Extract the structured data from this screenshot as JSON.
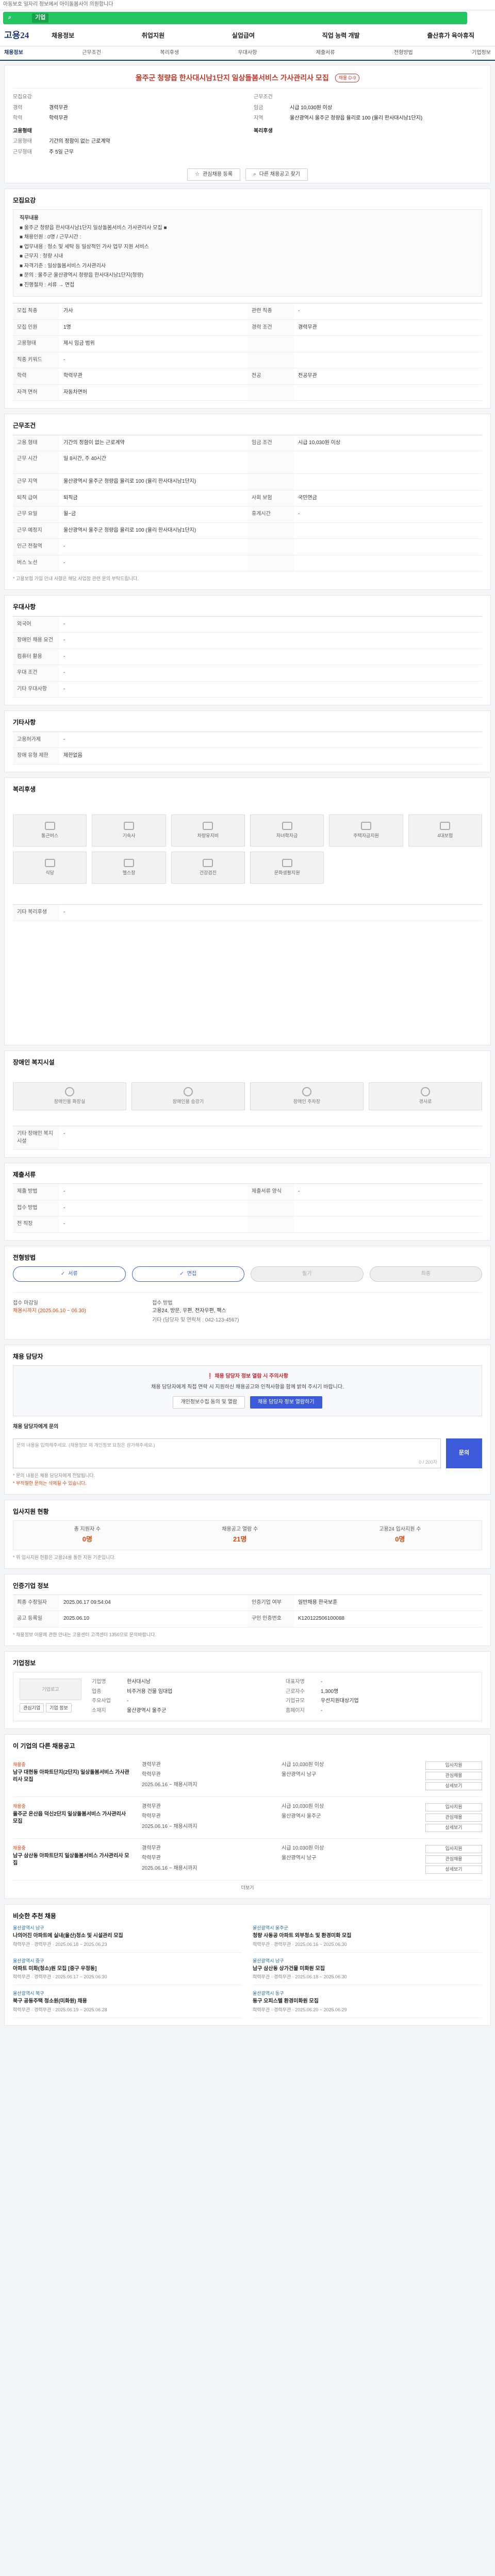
{
  "topbar": {
    "text": "아동보호 일자리 정보에서 아이돌봄사이 의원합니다"
  },
  "search": {
    "label": "기업",
    "value": ""
  },
  "gnb": {
    "logo": "고용24",
    "menu": [
      "채용정보",
      "취업지원",
      "실업급여",
      "직업 능력 개발",
      "출산휴가 육아휴직"
    ]
  },
  "tabs": [
    {
      "label": "채용정보",
      "active": true
    },
    {
      "label": "근무조건"
    },
    {
      "label": "복리후생"
    },
    {
      "label": "우대사항"
    },
    {
      "label": "제출서류"
    },
    {
      "label": "전형방법"
    },
    {
      "label": "기업정보"
    }
  ],
  "job": {
    "title": "울주군 청량읍 한사대시남1단지 일상돌봄서비스 가사관리사 모집",
    "status": "채용 D-9",
    "left": [
      {
        "k": "모집요강",
        "v": ""
      },
      {
        "k": "경력",
        "v": "경력무관"
      },
      {
        "k": "학력",
        "v": "학력무관"
      }
    ],
    "left_sub_title": "고용형태",
    "left_sub": [
      {
        "k": "고용형태",
        "v": "기간의 정함이 없는 근로계약"
      },
      {
        "k": "근무형태",
        "v": "주 5일 근무"
      }
    ],
    "right": [
      {
        "k": "근무조건",
        "v": ""
      },
      {
        "k": "임금",
        "v": "시급 10,030원 이상"
      },
      {
        "k": "지역",
        "v": "울산광역시 울주군 청량읍 율리로 100 (율리 한사대시남1단지)"
      }
    ],
    "right_sub_title": "복리후생",
    "buttons": [
      "관심채용 등록",
      "다른 채용공고 찾기"
    ]
  },
  "recruit_summary": {
    "title": "모집요강",
    "box_title": "직무내용",
    "lines": [
      "■ 울주군 청량읍 한사대시남1단지 일상돌봄서비스 가사관리사 모집 ■",
      "■ 채용인원 : 0명 / 근무시간 :",
      "■ 업무내용 : 청소 및 세탁 등 일상적인 가사 업무 지원 서비스",
      "■ 근무지 : 청량 시내",
      "■ 자격기준 : 일상돌봄서비스 가사관리사",
      "■ 문의 : 울주군 울산광역시 청량읍 한사대시남1단지(청량)",
      "■ 진행절차 : 서류 → 면접"
    ]
  },
  "recruit_grid": [
    [
      "모집 직종",
      "가사",
      "관련 직종",
      "-"
    ],
    [
      "모집 인원",
      "1명",
      "경력 조건",
      "경력무관"
    ],
    [
      "고용형태",
      "제시 임금 범위",
      "",
      ""
    ],
    [
      "직종 키워드",
      "-",
      "",
      ""
    ],
    [
      "학력",
      "학력무관",
      "전공",
      "전공무관"
    ],
    [
      "자격 면허",
      "자동차면허",
      "",
      ""
    ]
  ],
  "work_conditions": {
    "title": "근무조건",
    "rows": [
      [
        "고용 형태",
        "기간의 정함이 없는 근로계약",
        "임금 조건",
        "시급 10,030원 이상"
      ],
      [
        "근무 시간",
        "일 8시간, 주 40시간",
        "",
        ""
      ],
      [
        "근무 지역",
        "울산광역시 울주군 청량읍 율리로 100 (율리 한사대시남1단지)",
        "",
        ""
      ],
      [
        "퇴직 급여",
        "퇴직금",
        "사회 보험",
        "국민연금"
      ],
      [
        "근무 요일",
        "월~금",
        "휴게시간",
        "-"
      ],
      [
        "근무 예정지",
        "울산광역시 울주군 청량읍 율리로 100 (율리 한사대시남1단지)",
        "",
        ""
      ],
      [
        "인근 전철역",
        "-",
        "",
        ""
      ],
      [
        "버스 노선",
        "-",
        "",
        ""
      ]
    ],
    "note": "* 고용보험 가입 안내 사항은 해당 사업장 관련 문의 부탁드립니다."
  },
  "preference": {
    "title": "우대사항",
    "rows": [
      [
        "외국어",
        "-"
      ],
      [
        "장애인 채용 요건",
        "-"
      ],
      [
        "컴퓨터 활용",
        "-"
      ],
      [
        "우대 조건",
        "-"
      ],
      [
        "기타 우대사항",
        "-"
      ]
    ]
  },
  "etc_info": {
    "title": "기타사항",
    "rows": [
      [
        "고용허가제",
        "-"
      ],
      [
        "장애 유형 제한",
        "제한없음"
      ]
    ]
  },
  "welfare": {
    "title": "복리후생",
    "items": [
      "통근버스",
      "기숙사",
      "차량유지비",
      "자녀학자금",
      "주택자금지원",
      "4대보험",
      "식당",
      "헬스장",
      "건강검진",
      "문화생활지원"
    ],
    "etc_label": "기타 복리후생",
    "etc_value": "-"
  },
  "disability": {
    "title": "장애인 복지시설",
    "items": [
      "장애인용 화장실",
      "장애인용 승강기",
      "장애인 주차장",
      "경사로"
    ],
    "etc_label": "기타 장애인 복지시설",
    "etc_value": "-"
  },
  "documents": {
    "title": "제출서류",
    "rows": [
      [
        "제출 방법",
        "-",
        "제출서류 양식",
        "-"
      ],
      [
        "접수 방법",
        "-",
        "",
        ""
      ],
      [
        "전 직장",
        "-",
        "",
        ""
      ]
    ]
  },
  "screening": {
    "title": "전형방법",
    "steps": [
      {
        "label": "서류",
        "state": "done"
      },
      {
        "label": "면접",
        "state": "done"
      },
      {
        "label": "필기",
        "state": "off"
      },
      {
        "label": "최종",
        "state": "off"
      }
    ],
    "deadline_label": "접수 마감일",
    "deadline_value": "채용시까지 (2025.06.10 ~ 06.30)",
    "method_label": "접수 방법",
    "method_value": "고용24, 방문, 우편, 전자우편, 팩스",
    "contact": "기타 (담당자 및 연락처 : 042-123-4567)"
  },
  "inquiry": {
    "title": "채용 담당자",
    "warn": "채용 담당자 정보 열람 시 주의사항",
    "desc": "채용 담당자에게 직접 연락 시 지원하신 채용공고와 인적사항을 함께 밝혀 주시기 바랍니다.",
    "buttons": [
      "개인정보수집 동의 및 열람",
      "채용 담당자 정보 열람하기"
    ],
    "form_title": "채용 담당자에게 문의",
    "placeholder": "문의 내용을 입력해주세요. (채용정보 외 개인정보 요청은 삼가해주세요.)",
    "counter": "0 / 200자",
    "submit": "문의",
    "notes": [
      "* 문의 내용은 채용 담당자에게 전달됩니다.",
      "* 부적절한 문의는 삭제될 수 있습니다."
    ]
  },
  "stats": {
    "title": "입사지원 현황",
    "items": [
      {
        "label": "총 지원자 수",
        "value": "0명"
      },
      {
        "label": "채용공고 열람 수",
        "value": "21명"
      },
      {
        "label": "고용24 입사지원 수",
        "value": "0명"
      }
    ],
    "note": "* 위 입사지원 현황은 고용24를 통한 지원 기준입니다."
  },
  "registry": {
    "title": "인증기업 정보",
    "rows": [
      [
        "최종 수정일자",
        "2025.06.17 09:54:04",
        "인증기업 여부",
        "일반채용 한국보훈"
      ],
      [
        "공고 등록일",
        "2025.06.10",
        "구인 인증번호",
        "K120122506100088"
      ]
    ],
    "note": "* 채용정보 이용에 관한 안내는 고용센터 고객센터 1350으로 문의바랍니다."
  },
  "company": {
    "title": "기업정보",
    "logo_alt": "기업로고",
    "rows": [
      [
        "기업명",
        "한사대시남",
        "대표자명",
        "-"
      ],
      [
        "업종",
        "비주거용 건물 임대업",
        "근로자수",
        "1,300명"
      ],
      [
        "주요사업",
        "-",
        "기업규모",
        "우선지원대상기업"
      ],
      [
        "소재지",
        "울산광역시 울주군",
        "홈페이지",
        "-"
      ]
    ],
    "buttons": [
      "관심기업",
      "기업 정보"
    ]
  },
  "other_jobs": {
    "title": "이 기업의 다른 채용공고",
    "items": [
      {
        "tag": "채용중",
        "title": "남구 대현동 아파트단지(2단지) 일상돌봄서비스 가사관리사 모집",
        "career": "경력무관",
        "edu": "학력무관",
        "pay": "시급 10,030원 이상",
        "loc": "울산광역시 남구",
        "date": "2025.06.16 ~ 채용시까지"
      },
      {
        "tag": "채용중",
        "title": "울주군 온산읍 덕신2단지 일상돌봄서비스 가사관리사 모집",
        "career": "경력무관",
        "edu": "학력무관",
        "pay": "시급 10,030원 이상",
        "loc": "울산광역시 울주군",
        "date": "2025.06.16 ~ 채용시까지"
      },
      {
        "tag": "채용중",
        "title": "남구 삼산동 아파트단지 일상돌봄서비스 가사관리사 모집",
        "career": "경력무관",
        "edu": "학력무관",
        "pay": "시급 10,030원 이상",
        "loc": "울산광역시 남구",
        "date": "2025.06.16 ~ 채용시까지"
      }
    ],
    "item_buttons": [
      "입사지원",
      "관심채용",
      "상세보기"
    ]
  },
  "recommend": {
    "title": "비슷한 추천 채용",
    "items": [
      {
        "tag": "울산광역시 남구",
        "title": "나의어진 아파트에 실내(울산)청소 및 시설관리 모집",
        "meta": "학력무관 · 경력무관 · 2025.06.18 ~ 2025.06.23"
      },
      {
        "tag": "울산광역시 울주군",
        "title": "청량 사동공 아파트 외부청소 및 환경미화 모집",
        "meta": "학력무관 · 경력무관 · 2025.06.16 ~ 2025.06.30"
      },
      {
        "tag": "울산광역시 중구",
        "title": "아파트 미화(청소)원 모집 [중구 우정동]",
        "meta": "학력무관 · 경력무관 · 2025.06.17 ~ 2025.06.30"
      },
      {
        "tag": "울산광역시 남구",
        "title": "남구 삼산동 상가건물 미화원 모집",
        "meta": "학력무관 · 경력무관 · 2025.06.18 ~ 2025.06.30"
      },
      {
        "tag": "울산광역시 북구",
        "title": "북구 공동주택 청소원(미화원) 채용",
        "meta": "학력무관 · 경력무관 · 2025.06.19 ~ 2025.06.28"
      },
      {
        "tag": "울산광역시 동구",
        "title": "동구 오피스텔 환경미화원 모집",
        "meta": "학력무관 · 경력무관 · 2025.06.20 ~ 2025.06.29"
      }
    ]
  },
  "more": "더보기"
}
